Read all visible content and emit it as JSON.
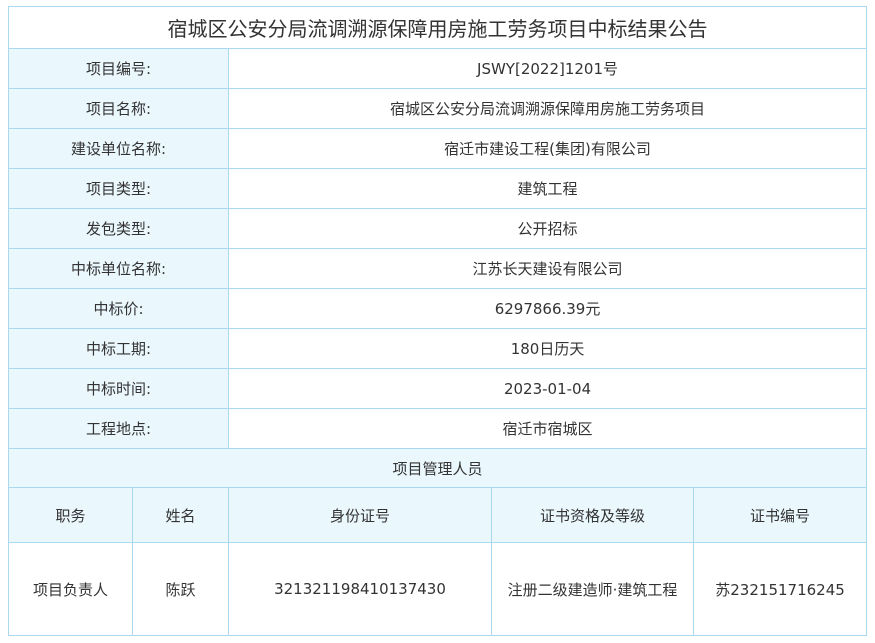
{
  "title": "宿城区公安分局流调溯源保障用房施工劳务项目中标结果公告",
  "fields": [
    {
      "label": "项目编号:",
      "value": "JSWY[2022]1201号"
    },
    {
      "label": "项目名称:",
      "value": "宿城区公安分局流调溯源保障用房施工劳务项目"
    },
    {
      "label": "建设单位名称:",
      "value": "宿迁市建设工程(集团)有限公司"
    },
    {
      "label": "项目类型:",
      "value": "建筑工程"
    },
    {
      "label": "发包类型:",
      "value": "公开招标"
    },
    {
      "label": "中标单位名称:",
      "value": "江苏长天建设有限公司"
    },
    {
      "label": "中标价:",
      "value": "6297866.39元"
    },
    {
      "label": "中标工期:",
      "value": "180日历天"
    },
    {
      "label": "中标时间:",
      "value": "2023-01-04"
    },
    {
      "label": "工程地点:",
      "value": "宿迁市宿城区"
    }
  ],
  "staff_section": {
    "title": "项目管理人员",
    "headers": [
      "职务",
      "姓名",
      "身份证号",
      "证书资格及等级",
      "证书编号"
    ],
    "rows": [
      [
        "项目负责人",
        "陈跃",
        "321321198410137430",
        "注册二级建造师·建筑工程",
        "苏232151716245"
      ]
    ]
  },
  "colors": {
    "border": "#a9d8ef",
    "label_bg": "#eaf7fd",
    "text": "#333333"
  }
}
